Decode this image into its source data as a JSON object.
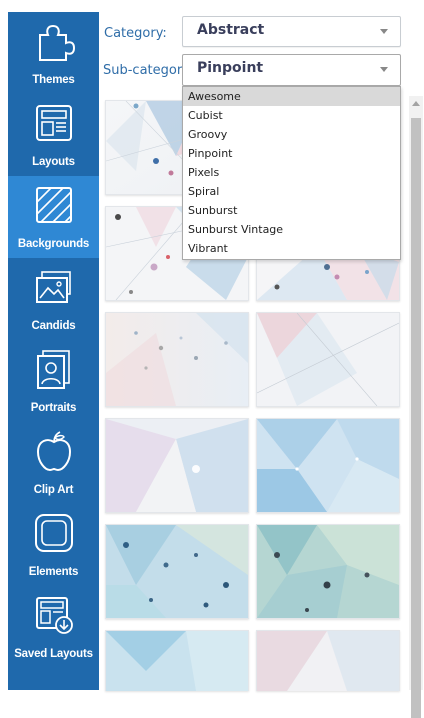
{
  "sidebar": {
    "items": [
      {
        "label": "Themes",
        "icon": "puzzle-icon"
      },
      {
        "label": "Layouts",
        "icon": "layout-icon"
      },
      {
        "label": "Backgrounds",
        "icon": "hatched-square-icon",
        "active": true
      },
      {
        "label": "Candids",
        "icon": "photo-icon"
      },
      {
        "label": "Portraits",
        "icon": "portrait-icon"
      },
      {
        "label": "Clip Art",
        "icon": "apple-icon"
      },
      {
        "label": "Elements",
        "icon": "rounded-square-icon"
      },
      {
        "label": "Saved Layouts",
        "icon": "saved-layout-icon"
      }
    ],
    "colors": {
      "background": "#1f69ac",
      "active": "#2f88d4"
    }
  },
  "filters": {
    "category_label": "Category:",
    "category_value": "Abstract",
    "subcategory_label": "Sub-category:",
    "subcategory_value": "Pinpoint"
  },
  "dropdown": {
    "options": [
      "Awesome",
      "Cubist",
      "Groovy",
      "Pinpoint",
      "Pixels",
      "Spiral",
      "Sunburst",
      "Sunburst Vintage",
      "Vibrant"
    ],
    "highlighted": "Awesome"
  },
  "thumbnails": {
    "count": 12,
    "style": "abstract geometric polygons with dots in pastel blues, pinks and greys"
  }
}
